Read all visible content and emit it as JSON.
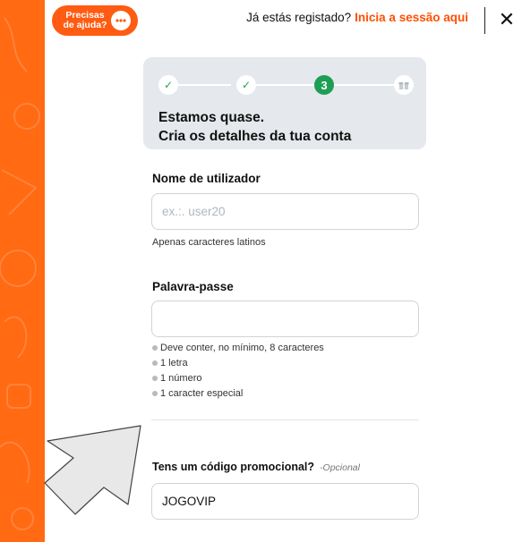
{
  "help_button": {
    "label_line1": "Precisas",
    "label_line2": "de ajuda?"
  },
  "header": {
    "already_registered": "Já estás registado?",
    "login_link": "Inicia a sessão aqui",
    "close_symbol": "✕"
  },
  "steps": {
    "items": [
      {
        "state": "done",
        "symbol": "✓"
      },
      {
        "state": "done",
        "symbol": "✓"
      },
      {
        "state": "active",
        "symbol": "3"
      },
      {
        "state": "pending",
        "icon": "gift-icon"
      }
    ],
    "title_line1": "Estamos quase.",
    "title_line2": "Cria os detalhes da tua conta"
  },
  "username": {
    "label": "Nome de utilizador",
    "placeholder": "ex.:. user20",
    "value": "",
    "hint": "Apenas caracteres latinos"
  },
  "password": {
    "label": "Palavra-passe",
    "value": "",
    "rules": [
      "Deve conter, no mínimo, 8 caracteres",
      "1 letra",
      "1 número",
      "1 caracter especial"
    ]
  },
  "promo": {
    "label": "Tens um código promocional?",
    "optional": "-Opcional",
    "value": "JOGOVIP"
  },
  "colors": {
    "brand": "#ff5b12",
    "link": "#ff4f00",
    "step_done": "#1fa355",
    "steps_bg": "#e5e8ec"
  }
}
